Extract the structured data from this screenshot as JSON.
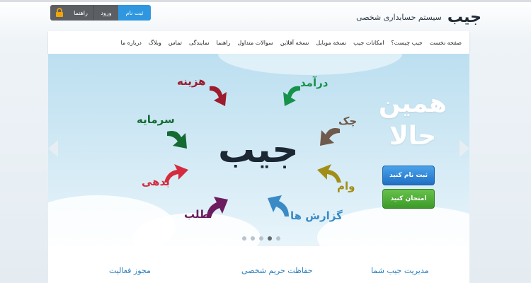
{
  "header": {
    "logo": "جیب",
    "subtitle": "سیستم حسابداری شخصی",
    "auth": {
      "signup": "ثبت نام",
      "login": "ورود",
      "help": "راهنما"
    }
  },
  "nav": {
    "items": [
      "صفحه نخست",
      "جیب چیست؟",
      "امکانات جیب",
      "نسخه موبایل",
      "نسخه آفلاین",
      "سوالات متداول",
      "راهنما",
      "نمایندگی",
      "تماس",
      "وبلاگ",
      "درباره ما"
    ]
  },
  "hero": {
    "title_line1": "همین",
    "title_line2": "حالا",
    "center_word": "جیب",
    "cta_signup": "ثبت نام کنید",
    "cta_try": "امتحان کنید",
    "labels": {
      "expense": "هزینه",
      "income": "درآمد",
      "capital": "سرمایه",
      "check": "چک",
      "debt": "بدهی",
      "loan": "وام",
      "request": "طلب",
      "reports": "گزارش ها"
    },
    "colors": {
      "expense": "#9d1b2c",
      "income": "#16924a",
      "capital": "#136b32",
      "check": "#6f5a4c",
      "debt": "#d52b3e",
      "loan": "#a28e16",
      "request": "#6b1d5f",
      "reports": "#3a8ac6"
    },
    "slider_dots": 5,
    "slider_active": 3
  },
  "features": {
    "manage": "مدیریت جیب شما",
    "privacy": "حفاظت حریم شخصی",
    "license": "مجوز فعالیت"
  }
}
